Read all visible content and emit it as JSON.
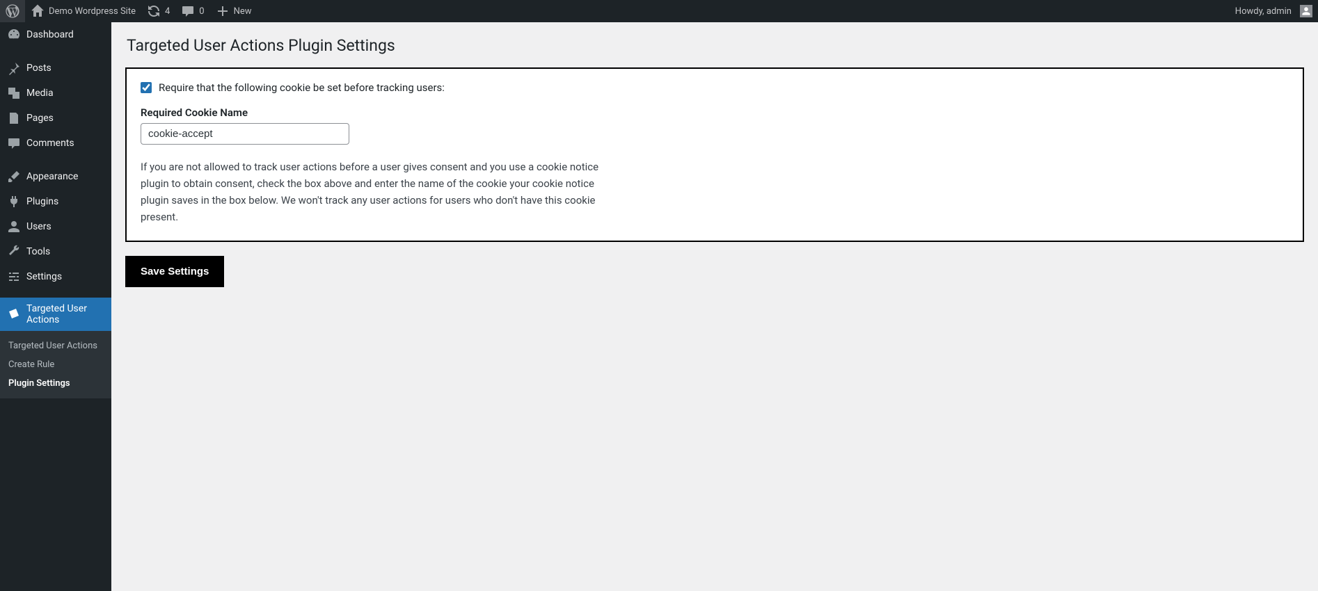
{
  "adminbar": {
    "site_name": "Demo Wordpress Site",
    "updates_count": "4",
    "comments_count": "0",
    "new_label": "New",
    "howdy_prefix": "Howdy, ",
    "user_name": "admin"
  },
  "sidebar": {
    "items": [
      {
        "label": "Dashboard"
      },
      {
        "label": "Posts"
      },
      {
        "label": "Media"
      },
      {
        "label": "Pages"
      },
      {
        "label": "Comments"
      },
      {
        "label": "Appearance"
      },
      {
        "label": "Plugins"
      },
      {
        "label": "Users"
      },
      {
        "label": "Tools"
      },
      {
        "label": "Settings"
      },
      {
        "label": "Targeted User Actions"
      }
    ],
    "submenu": [
      {
        "label": "Targeted User Actions"
      },
      {
        "label": "Create Rule"
      },
      {
        "label": "Plugin Settings"
      }
    ]
  },
  "page": {
    "title": "Targeted User Actions Plugin Settings",
    "require_cookie_label": "Require that the following cookie be set before tracking users:",
    "cookie_name_label": "Required Cookie Name",
    "cookie_name_value": "cookie-accept",
    "help_text": "If you are not allowed to track user actions before a user gives consent and you use a cookie notice plugin to obtain consent, check the box above and enter the name of the cookie your cookie notice plugin saves in the box below. We won't track any user actions for users who don't have this cookie present.",
    "save_label": "Save Settings"
  }
}
